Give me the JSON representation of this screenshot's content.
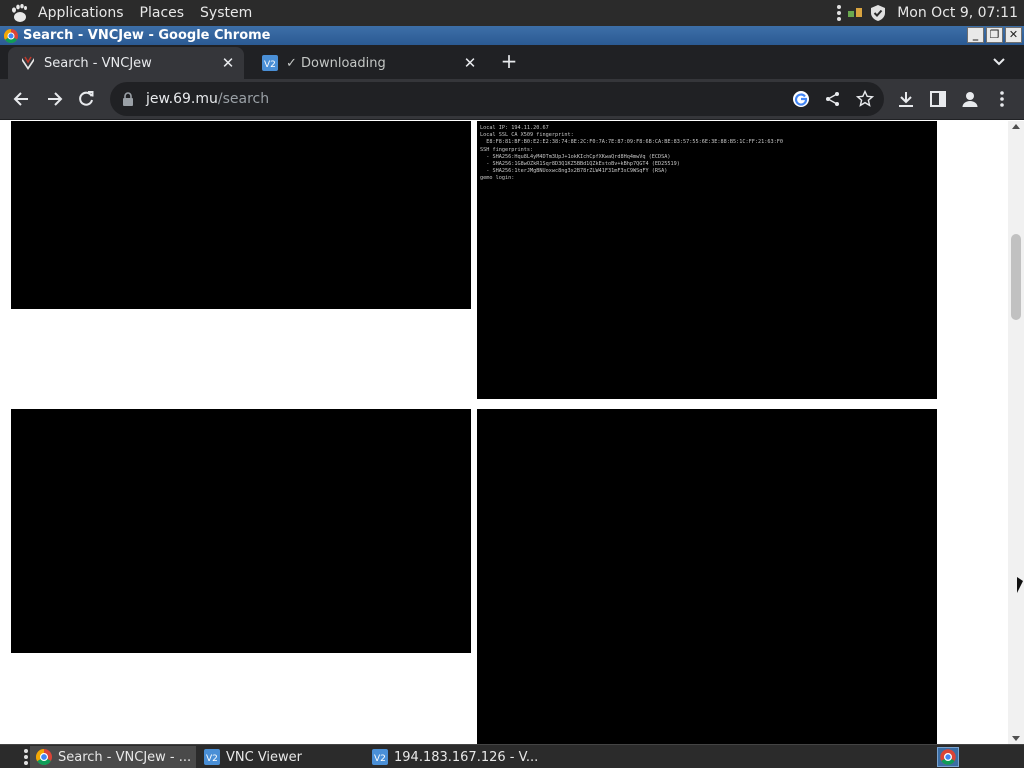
{
  "top_panel": {
    "menus": [
      "Applications",
      "Places",
      "System"
    ],
    "clock": "Mon Oct  9, 07:11"
  },
  "window": {
    "title": "Search - VNCJew - Google Chrome",
    "controls": [
      "_",
      "❐",
      "✕"
    ]
  },
  "tabs": [
    {
      "label": "Search - VNCJew",
      "favicon": "vncjew-logo-icon",
      "active": true
    },
    {
      "label": "✓ Downloading",
      "favicon": "vnc-viewer-icon",
      "active": false
    }
  ],
  "toolbar": {
    "url_host": "jew.69.mu",
    "url_path": "/search"
  },
  "page": {
    "console_lines": [
      "Local IP: 194.11.20.67",
      "Local SSL CA X509 fingerprint:",
      "  E8:F8:81:BF:B0:E2:E2:38:74:8E:2C:F0:7A:7E:87:09:F8:6B:CA:BE:83:57:55:6E:3E:88:B5:1C:FF:21:63:F0",
      "SSH fingerprints:",
      "  - SHA256:Hqu8L4yM4DTm3UpJ+1okKIchCpfXKwaQrd8Hq4mwVq (ECDSA)",
      "  - SHA256:1G8wOZkR1Sqr8D3Q1KZ5BBd1QZkEstoBv+kBhp7QGT4 (ED25519)",
      "  - SHA256:1terJMgBNUoxwc8ng3x2B78rZLW41F31mF3sC9WSqFY (RSA)",
      "gemo login:"
    ]
  },
  "taskbar": {
    "tasks": [
      {
        "label": "Search - VNCJew - ...",
        "icon": "chrome-icon"
      },
      {
        "label": "VNC Viewer",
        "icon": "vnc-viewer-icon"
      },
      {
        "label": "194.183.167.126 - V...",
        "icon": "vnc-viewer-icon"
      }
    ]
  },
  "colors": {
    "panel": "#2b2b2b",
    "titlebar": "#2b5a93",
    "tabstrip": "#202124",
    "toolbar": "#35363a"
  }
}
